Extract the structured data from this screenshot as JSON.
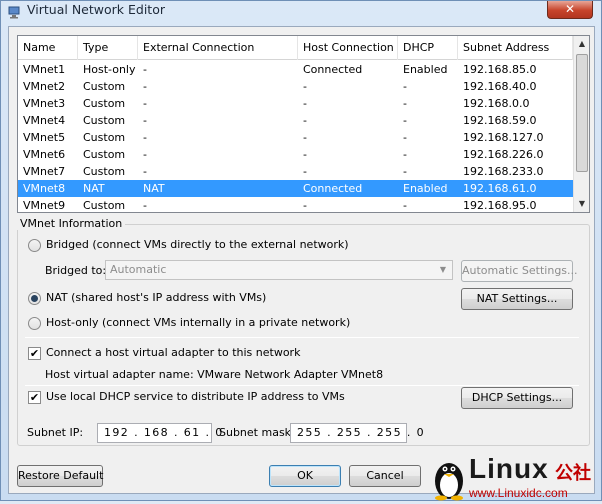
{
  "window": {
    "title": "Virtual Network Editor",
    "close_glyph": "✕"
  },
  "list": {
    "columns": [
      "Name",
      "Type",
      "External Connection",
      "Host Connection",
      "DHCP",
      "Subnet Address"
    ],
    "rows": [
      [
        "VMnet1",
        "Host-only",
        "-",
        "Connected",
        "Enabled",
        "192.168.85.0"
      ],
      [
        "VMnet2",
        "Custom",
        "-",
        "-",
        "-",
        "192.168.40.0"
      ],
      [
        "VMnet3",
        "Custom",
        "-",
        "-",
        "-",
        "192.168.0.0"
      ],
      [
        "VMnet4",
        "Custom",
        "-",
        "-",
        "-",
        "192.168.59.0"
      ],
      [
        "VMnet5",
        "Custom",
        "-",
        "-",
        "-",
        "192.168.127.0"
      ],
      [
        "VMnet6",
        "Custom",
        "-",
        "-",
        "-",
        "192.168.226.0"
      ],
      [
        "VMnet7",
        "Custom",
        "-",
        "-",
        "-",
        "192.168.233.0"
      ],
      [
        "VMnet8",
        "NAT",
        "NAT",
        "Connected",
        "Enabled",
        "192.168.61.0"
      ],
      [
        "VMnet9",
        "Custom",
        "-",
        "-",
        "-",
        "192.168.95.0"
      ]
    ],
    "selected_index": 7
  },
  "vmnet_info": {
    "label": "VMnet Information",
    "bridged": "Bridged (connect VMs directly to the external network)",
    "bridged_to_label": "Bridged to:",
    "bridged_to_value": "Automatic",
    "automatic_settings": "Automatic Settings...",
    "nat": "NAT (shared host's IP address with VMs)",
    "nat_settings": "NAT Settings...",
    "host_only": "Host-only (connect VMs internally in a private network)",
    "connect_adapter": "Connect a host virtual adapter to this network",
    "adapter_name": "Host virtual adapter name: VMware Network Adapter VMnet8",
    "use_dhcp": "Use local DHCP service to distribute IP address to VMs",
    "dhcp_settings": "DHCP Settings...",
    "subnet_ip_label": "Subnet IP:",
    "subnet_ip": "192 . 168 . 61 . 0",
    "subnet_mask_label": "Subnet mask:",
    "subnet_mask": "255 . 255 . 255 . 0",
    "selected_mode": "nat",
    "connect_adapter_checked": true,
    "use_dhcp_checked": true
  },
  "buttons": {
    "restore_default": "Restore Default",
    "ok": "OK",
    "cancel": "Cancel"
  },
  "watermark": {
    "brand": "Linux",
    "suffix": "公社",
    "url": "www.Linuxidc.com"
  }
}
